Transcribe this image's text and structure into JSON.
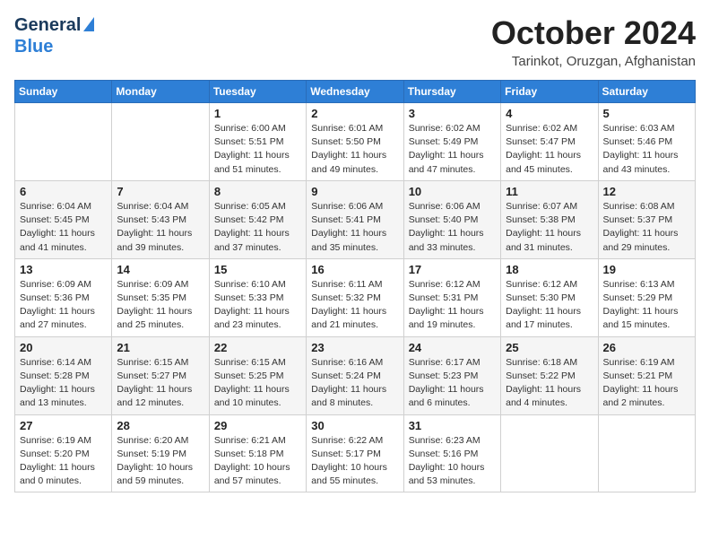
{
  "header": {
    "logo_line1": "General",
    "logo_line2": "Blue",
    "month": "October 2024",
    "location": "Tarinkot, Oruzgan, Afghanistan"
  },
  "weekdays": [
    "Sunday",
    "Monday",
    "Tuesday",
    "Wednesday",
    "Thursday",
    "Friday",
    "Saturday"
  ],
  "weeks": [
    [
      {
        "num": "",
        "detail": ""
      },
      {
        "num": "",
        "detail": ""
      },
      {
        "num": "1",
        "detail": "Sunrise: 6:00 AM\nSunset: 5:51 PM\nDaylight: 11 hours and 51 minutes."
      },
      {
        "num": "2",
        "detail": "Sunrise: 6:01 AM\nSunset: 5:50 PM\nDaylight: 11 hours and 49 minutes."
      },
      {
        "num": "3",
        "detail": "Sunrise: 6:02 AM\nSunset: 5:49 PM\nDaylight: 11 hours and 47 minutes."
      },
      {
        "num": "4",
        "detail": "Sunrise: 6:02 AM\nSunset: 5:47 PM\nDaylight: 11 hours and 45 minutes."
      },
      {
        "num": "5",
        "detail": "Sunrise: 6:03 AM\nSunset: 5:46 PM\nDaylight: 11 hours and 43 minutes."
      }
    ],
    [
      {
        "num": "6",
        "detail": "Sunrise: 6:04 AM\nSunset: 5:45 PM\nDaylight: 11 hours and 41 minutes."
      },
      {
        "num": "7",
        "detail": "Sunrise: 6:04 AM\nSunset: 5:43 PM\nDaylight: 11 hours and 39 minutes."
      },
      {
        "num": "8",
        "detail": "Sunrise: 6:05 AM\nSunset: 5:42 PM\nDaylight: 11 hours and 37 minutes."
      },
      {
        "num": "9",
        "detail": "Sunrise: 6:06 AM\nSunset: 5:41 PM\nDaylight: 11 hours and 35 minutes."
      },
      {
        "num": "10",
        "detail": "Sunrise: 6:06 AM\nSunset: 5:40 PM\nDaylight: 11 hours and 33 minutes."
      },
      {
        "num": "11",
        "detail": "Sunrise: 6:07 AM\nSunset: 5:38 PM\nDaylight: 11 hours and 31 minutes."
      },
      {
        "num": "12",
        "detail": "Sunrise: 6:08 AM\nSunset: 5:37 PM\nDaylight: 11 hours and 29 minutes."
      }
    ],
    [
      {
        "num": "13",
        "detail": "Sunrise: 6:09 AM\nSunset: 5:36 PM\nDaylight: 11 hours and 27 minutes."
      },
      {
        "num": "14",
        "detail": "Sunrise: 6:09 AM\nSunset: 5:35 PM\nDaylight: 11 hours and 25 minutes."
      },
      {
        "num": "15",
        "detail": "Sunrise: 6:10 AM\nSunset: 5:33 PM\nDaylight: 11 hours and 23 minutes."
      },
      {
        "num": "16",
        "detail": "Sunrise: 6:11 AM\nSunset: 5:32 PM\nDaylight: 11 hours and 21 minutes."
      },
      {
        "num": "17",
        "detail": "Sunrise: 6:12 AM\nSunset: 5:31 PM\nDaylight: 11 hours and 19 minutes."
      },
      {
        "num": "18",
        "detail": "Sunrise: 6:12 AM\nSunset: 5:30 PM\nDaylight: 11 hours and 17 minutes."
      },
      {
        "num": "19",
        "detail": "Sunrise: 6:13 AM\nSunset: 5:29 PM\nDaylight: 11 hours and 15 minutes."
      }
    ],
    [
      {
        "num": "20",
        "detail": "Sunrise: 6:14 AM\nSunset: 5:28 PM\nDaylight: 11 hours and 13 minutes."
      },
      {
        "num": "21",
        "detail": "Sunrise: 6:15 AM\nSunset: 5:27 PM\nDaylight: 11 hours and 12 minutes."
      },
      {
        "num": "22",
        "detail": "Sunrise: 6:15 AM\nSunset: 5:25 PM\nDaylight: 11 hours and 10 minutes."
      },
      {
        "num": "23",
        "detail": "Sunrise: 6:16 AM\nSunset: 5:24 PM\nDaylight: 11 hours and 8 minutes."
      },
      {
        "num": "24",
        "detail": "Sunrise: 6:17 AM\nSunset: 5:23 PM\nDaylight: 11 hours and 6 minutes."
      },
      {
        "num": "25",
        "detail": "Sunrise: 6:18 AM\nSunset: 5:22 PM\nDaylight: 11 hours and 4 minutes."
      },
      {
        "num": "26",
        "detail": "Sunrise: 6:19 AM\nSunset: 5:21 PM\nDaylight: 11 hours and 2 minutes."
      }
    ],
    [
      {
        "num": "27",
        "detail": "Sunrise: 6:19 AM\nSunset: 5:20 PM\nDaylight: 11 hours and 0 minutes."
      },
      {
        "num": "28",
        "detail": "Sunrise: 6:20 AM\nSunset: 5:19 PM\nDaylight: 10 hours and 59 minutes."
      },
      {
        "num": "29",
        "detail": "Sunrise: 6:21 AM\nSunset: 5:18 PM\nDaylight: 10 hours and 57 minutes."
      },
      {
        "num": "30",
        "detail": "Sunrise: 6:22 AM\nSunset: 5:17 PM\nDaylight: 10 hours and 55 minutes."
      },
      {
        "num": "31",
        "detail": "Sunrise: 6:23 AM\nSunset: 5:16 PM\nDaylight: 10 hours and 53 minutes."
      },
      {
        "num": "",
        "detail": ""
      },
      {
        "num": "",
        "detail": ""
      }
    ]
  ]
}
